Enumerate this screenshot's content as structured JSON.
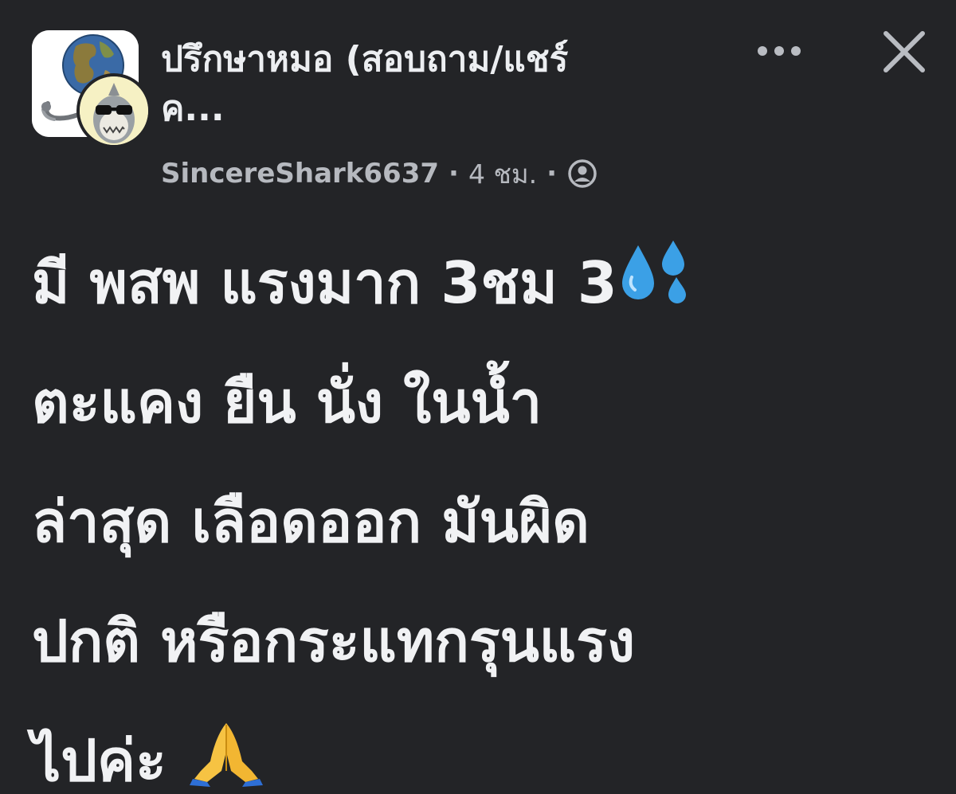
{
  "header": {
    "group_title": "ปรึกษาหมอ (สอบถาม/แชร์\nค...",
    "author": "SincereShark6637",
    "separator": "·",
    "time": "4 ชม."
  },
  "icons": {
    "group_avatar": "globe-stethoscope-icon",
    "user_avatar": "shark-sunglasses-icon",
    "more": "more-dots-icon",
    "close": "close-icon",
    "privacy": "private-group-icon",
    "sweat": "sweat-droplets-emoji",
    "pray": "folded-hands-emoji"
  },
  "post": {
    "lines": [
      "มี พสพ แรงมาก 3ชม 3",
      "ตะแคง ยืน นั่ง ในน้ำ",
      "ล่าสุด เลือดออก มันผิด",
      "ปกติ หรือกระแทกรุนแรง",
      "ไปค่ะ"
    ]
  },
  "colors": {
    "background": "#232427",
    "text": "#f1f2f4",
    "meta_text": "#b6b9bf"
  }
}
